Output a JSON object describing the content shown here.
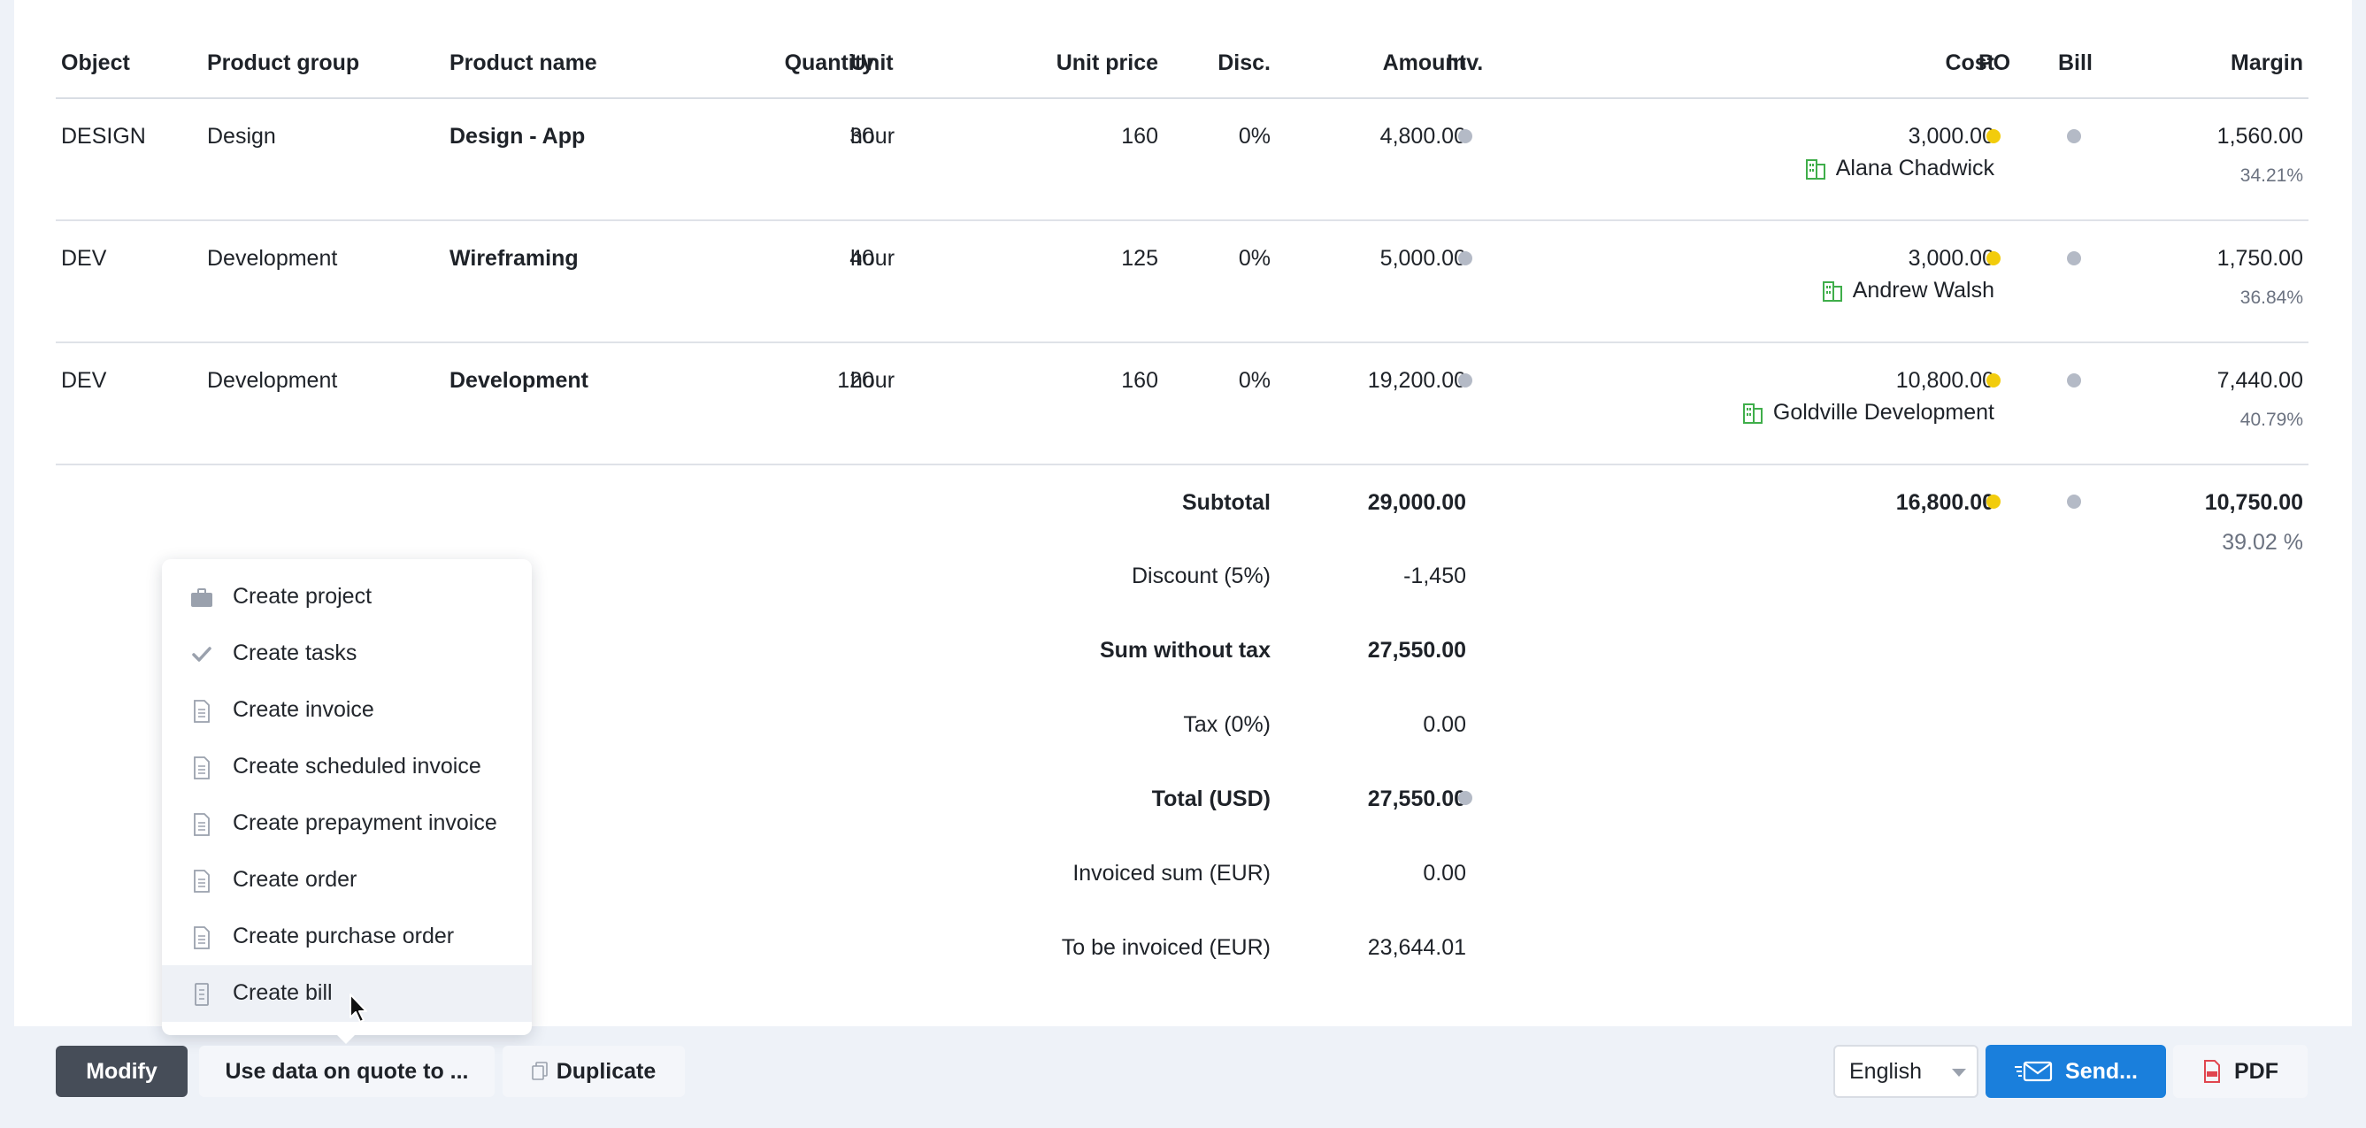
{
  "columns": {
    "object": "Object",
    "product_group": "Product group",
    "product_name": "Product name",
    "quantity": "Quantity",
    "unit": "Unit",
    "unit_price": "Unit price",
    "disc": "Disc.",
    "amount": "Amount",
    "inv": "Inv.",
    "cost": "Cost",
    "po": "PO",
    "bill": "Bill",
    "margin": "Margin"
  },
  "rows": [
    {
      "object": "DESIGN",
      "group": "Design",
      "name": "Design - App",
      "qty": "30",
      "unit": "hour",
      "price": "160",
      "disc": "0%",
      "amount": "4,800.00",
      "cost": "3,000.00",
      "vendor": "Alana Chadwick",
      "margin": "1,560.00",
      "margin_pct": "34.21%"
    },
    {
      "object": "DEV",
      "group": "Development",
      "name": "Wireframing",
      "qty": "40",
      "unit": "hour",
      "price": "125",
      "disc": "0%",
      "amount": "5,000.00",
      "cost": "3,000.00",
      "vendor": "Andrew Walsh",
      "margin": "1,750.00",
      "margin_pct": "36.84%"
    },
    {
      "object": "DEV",
      "group": "Development",
      "name": "Development",
      "qty": "120",
      "unit": "hour",
      "price": "160",
      "disc": "0%",
      "amount": "19,200.00",
      "cost": "10,800.00",
      "vendor": "Goldville Development",
      "margin": "7,440.00",
      "margin_pct": "40.79%"
    }
  ],
  "totals": {
    "subtotal_label": "Subtotal",
    "subtotal": "29,000.00",
    "subtotal_cost": "16,800.00",
    "subtotal_margin": "10,750.00",
    "subtotal_margin_pct": "39.02 %",
    "discount_label": "Discount (5%)",
    "discount": "-1,450",
    "sum_wo_tax_label": "Sum without tax",
    "sum_wo_tax": "27,550.00",
    "tax_label": "Tax (0%)",
    "tax": "0.00",
    "total_label": "Total (USD)",
    "total": "27,550.00",
    "invoiced_label": "Invoiced sum (EUR)",
    "invoiced": "0.00",
    "to_invoice_label": "To be invoiced (EUR)",
    "to_invoice": "23,644.01"
  },
  "menu": {
    "items": [
      {
        "label": "Create project",
        "icon": "briefcase-icon"
      },
      {
        "label": "Create tasks",
        "icon": "checkmark-icon"
      },
      {
        "label": "Create invoice",
        "icon": "document-icon"
      },
      {
        "label": "Create scheduled invoice",
        "icon": "document-icon"
      },
      {
        "label": "Create prepayment invoice",
        "icon": "document-icon"
      },
      {
        "label": "Create order",
        "icon": "document-icon"
      },
      {
        "label": "Create purchase order",
        "icon": "document-icon"
      },
      {
        "label": "Create bill",
        "icon": "bill-icon"
      }
    ]
  },
  "footer": {
    "modify": "Modify",
    "use_data": "Use data on quote to ...",
    "duplicate": "Duplicate",
    "language": "English",
    "send": "Send...",
    "pdf": "PDF"
  },
  "colors": {
    "accent": "#1a7fdc",
    "status_yellow": "#f2cc0c",
    "status_grey": "#b4bac6",
    "vendor_green": "#3fae4a",
    "pdf_red": "#e0464f"
  }
}
